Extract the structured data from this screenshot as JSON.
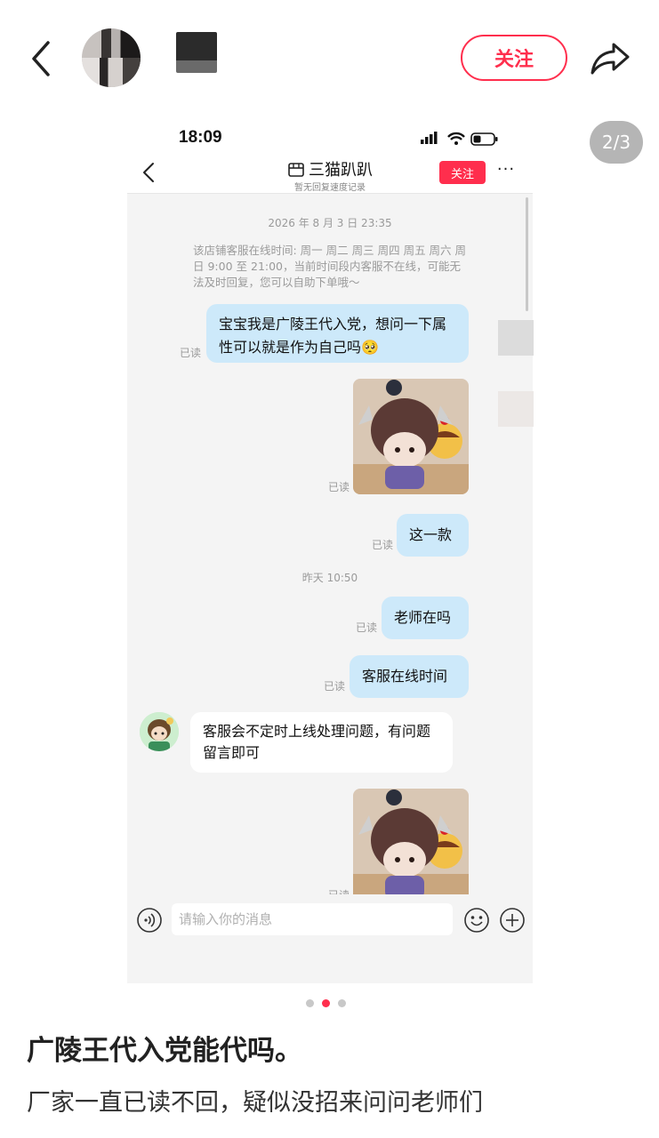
{
  "header": {
    "follow_label": "关注"
  },
  "badge": {
    "page_indicator": "2/3"
  },
  "screenshot": {
    "status_time": "18:09",
    "shop_name": "三猫趴趴",
    "shop_subtitle": "暂无回复速度记录",
    "follow_label": "关注",
    "more_label": "···",
    "timestamp_1": "2026 年 8 月 3 日 23:35",
    "notice": "该店铺客服在线时间: 周一 周二 周三 周四 周五 周六 周日 9:00 至 21:00，当前时间段内客服不在线，可能无法及时回复，您可以自助下单哦～",
    "messages": [
      {
        "from": "me",
        "text": "宝宝我是广陵王代入党，想问一下属性可以就是作为自己吗🥺",
        "status": "已读"
      },
      {
        "from": "me",
        "type": "image",
        "status": "已读"
      },
      {
        "from": "me",
        "text": "这一款",
        "status": "已读"
      },
      {
        "from": "me",
        "text": "老师在吗",
        "status": "已读"
      },
      {
        "from": "me",
        "text": "客服在线时间",
        "status": "已读"
      },
      {
        "from": "agent",
        "text": "客服会不定时上线处理问题，有问题留言即可"
      },
      {
        "from": "me",
        "type": "image",
        "status": "已读"
      }
    ],
    "timestamp_2": "昨天 10:50",
    "input_placeholder": "请输入你的消息"
  },
  "carousel": {
    "total": 3,
    "active": 2
  },
  "post": {
    "title": "广陵王代入党能代吗。",
    "body": "厂家一直已读不回，疑似没招来问问老师们"
  },
  "colors": {
    "accent": "#ff2e4d",
    "bubble_me": "#cde9fa",
    "chat_bg": "#f4f4f4"
  },
  "icons": [
    "back-arrow-icon",
    "share-icon",
    "signal-icon",
    "wifi-icon",
    "battery-icon",
    "shop-icon",
    "voice-icon",
    "emoji-icon",
    "plus-icon"
  ]
}
